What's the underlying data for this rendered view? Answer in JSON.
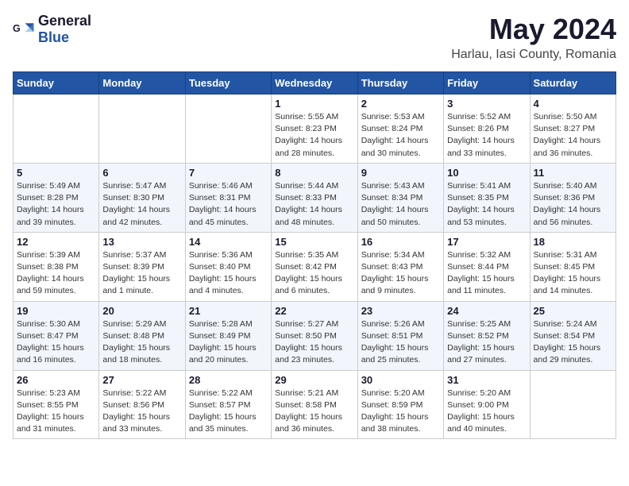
{
  "header": {
    "logo_general": "General",
    "logo_blue": "Blue",
    "title": "May 2024",
    "location": "Harlau, Iasi County, Romania"
  },
  "columns": [
    "Sunday",
    "Monday",
    "Tuesday",
    "Wednesday",
    "Thursday",
    "Friday",
    "Saturday"
  ],
  "weeks": [
    [
      {
        "day": "",
        "detail": ""
      },
      {
        "day": "",
        "detail": ""
      },
      {
        "day": "",
        "detail": ""
      },
      {
        "day": "1",
        "detail": "Sunrise: 5:55 AM\nSunset: 8:23 PM\nDaylight: 14 hours and 28 minutes."
      },
      {
        "day": "2",
        "detail": "Sunrise: 5:53 AM\nSunset: 8:24 PM\nDaylight: 14 hours and 30 minutes."
      },
      {
        "day": "3",
        "detail": "Sunrise: 5:52 AM\nSunset: 8:26 PM\nDaylight: 14 hours and 33 minutes."
      },
      {
        "day": "4",
        "detail": "Sunrise: 5:50 AM\nSunset: 8:27 PM\nDaylight: 14 hours and 36 minutes."
      }
    ],
    [
      {
        "day": "5",
        "detail": "Sunrise: 5:49 AM\nSunset: 8:28 PM\nDaylight: 14 hours and 39 minutes."
      },
      {
        "day": "6",
        "detail": "Sunrise: 5:47 AM\nSunset: 8:30 PM\nDaylight: 14 hours and 42 minutes."
      },
      {
        "day": "7",
        "detail": "Sunrise: 5:46 AM\nSunset: 8:31 PM\nDaylight: 14 hours and 45 minutes."
      },
      {
        "day": "8",
        "detail": "Sunrise: 5:44 AM\nSunset: 8:33 PM\nDaylight: 14 hours and 48 minutes."
      },
      {
        "day": "9",
        "detail": "Sunrise: 5:43 AM\nSunset: 8:34 PM\nDaylight: 14 hours and 50 minutes."
      },
      {
        "day": "10",
        "detail": "Sunrise: 5:41 AM\nSunset: 8:35 PM\nDaylight: 14 hours and 53 minutes."
      },
      {
        "day": "11",
        "detail": "Sunrise: 5:40 AM\nSunset: 8:36 PM\nDaylight: 14 hours and 56 minutes."
      }
    ],
    [
      {
        "day": "12",
        "detail": "Sunrise: 5:39 AM\nSunset: 8:38 PM\nDaylight: 14 hours and 59 minutes."
      },
      {
        "day": "13",
        "detail": "Sunrise: 5:37 AM\nSunset: 8:39 PM\nDaylight: 15 hours and 1 minute."
      },
      {
        "day": "14",
        "detail": "Sunrise: 5:36 AM\nSunset: 8:40 PM\nDaylight: 15 hours and 4 minutes."
      },
      {
        "day": "15",
        "detail": "Sunrise: 5:35 AM\nSunset: 8:42 PM\nDaylight: 15 hours and 6 minutes."
      },
      {
        "day": "16",
        "detail": "Sunrise: 5:34 AM\nSunset: 8:43 PM\nDaylight: 15 hours and 9 minutes."
      },
      {
        "day": "17",
        "detail": "Sunrise: 5:32 AM\nSunset: 8:44 PM\nDaylight: 15 hours and 11 minutes."
      },
      {
        "day": "18",
        "detail": "Sunrise: 5:31 AM\nSunset: 8:45 PM\nDaylight: 15 hours and 14 minutes."
      }
    ],
    [
      {
        "day": "19",
        "detail": "Sunrise: 5:30 AM\nSunset: 8:47 PM\nDaylight: 15 hours and 16 minutes."
      },
      {
        "day": "20",
        "detail": "Sunrise: 5:29 AM\nSunset: 8:48 PM\nDaylight: 15 hours and 18 minutes."
      },
      {
        "day": "21",
        "detail": "Sunrise: 5:28 AM\nSunset: 8:49 PM\nDaylight: 15 hours and 20 minutes."
      },
      {
        "day": "22",
        "detail": "Sunrise: 5:27 AM\nSunset: 8:50 PM\nDaylight: 15 hours and 23 minutes."
      },
      {
        "day": "23",
        "detail": "Sunrise: 5:26 AM\nSunset: 8:51 PM\nDaylight: 15 hours and 25 minutes."
      },
      {
        "day": "24",
        "detail": "Sunrise: 5:25 AM\nSunset: 8:52 PM\nDaylight: 15 hours and 27 minutes."
      },
      {
        "day": "25",
        "detail": "Sunrise: 5:24 AM\nSunset: 8:54 PM\nDaylight: 15 hours and 29 minutes."
      }
    ],
    [
      {
        "day": "26",
        "detail": "Sunrise: 5:23 AM\nSunset: 8:55 PM\nDaylight: 15 hours and 31 minutes."
      },
      {
        "day": "27",
        "detail": "Sunrise: 5:22 AM\nSunset: 8:56 PM\nDaylight: 15 hours and 33 minutes."
      },
      {
        "day": "28",
        "detail": "Sunrise: 5:22 AM\nSunset: 8:57 PM\nDaylight: 15 hours and 35 minutes."
      },
      {
        "day": "29",
        "detail": "Sunrise: 5:21 AM\nSunset: 8:58 PM\nDaylight: 15 hours and 36 minutes."
      },
      {
        "day": "30",
        "detail": "Sunrise: 5:20 AM\nSunset: 8:59 PM\nDaylight: 15 hours and 38 minutes."
      },
      {
        "day": "31",
        "detail": "Sunrise: 5:20 AM\nSunset: 9:00 PM\nDaylight: 15 hours and 40 minutes."
      },
      {
        "day": "",
        "detail": ""
      }
    ]
  ]
}
